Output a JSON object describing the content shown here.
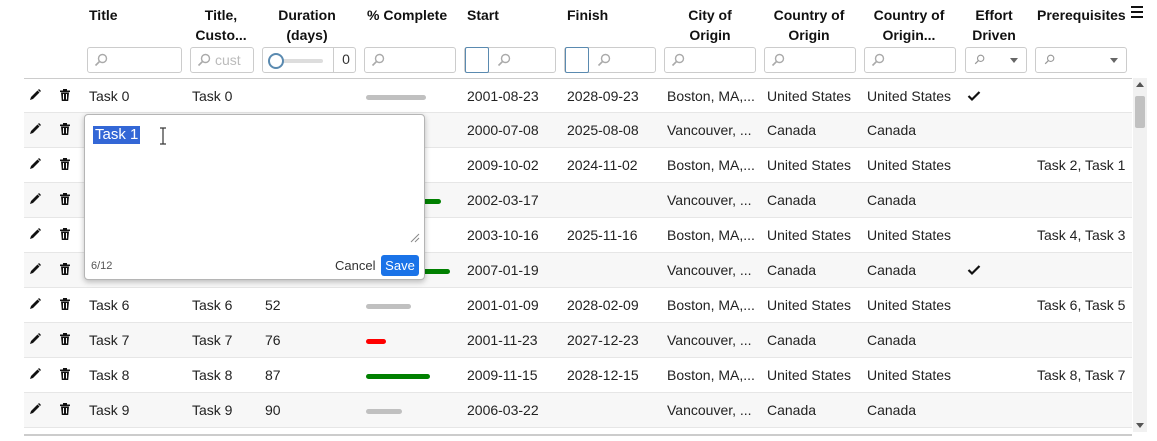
{
  "columns": {
    "title": "Title",
    "title_custom_l1": "Title,",
    "title_custom_l2": "Custo...",
    "duration_l1": "Duration",
    "duration_l2": "(days)",
    "percent": "% Complete",
    "start": "Start",
    "finish": "Finish",
    "city_l1": "City of",
    "city_l2": "Origin",
    "country_l1": "Country of",
    "country_l2": "Origin",
    "country2_l1": "Country of",
    "country2_l2": "Origin...",
    "effort_l1": "Effort",
    "effort_l2": "Driven",
    "prereq": "Prerequisites"
  },
  "filters": {
    "title_custom_placeholder": "cust",
    "duration_value": "0"
  },
  "colors": {
    "green": "#008000",
    "red": "#ff0000",
    "grey": "#c0c0c0",
    "accent": "#1a73e8"
  },
  "rows": [
    {
      "title": "Task 0",
      "title2": "Task 0",
      "duration": "",
      "pct": 0.6,
      "bar": "grey",
      "start": "2001-08-23",
      "finish": "2028-09-23",
      "city": "Boston, MA,...",
      "country": "United States",
      "country2": "United States",
      "effort": true,
      "prereq": ""
    },
    {
      "title": "",
      "title2": "",
      "duration": "",
      "pct": null,
      "bar": "",
      "start": "2000-07-08",
      "finish": "2025-08-08",
      "city": "Vancouver, ...",
      "country": "Canada",
      "country2": "Canada",
      "effort": false,
      "prereq": ""
    },
    {
      "title": "",
      "title2": "",
      "duration": "",
      "pct": null,
      "bar": "",
      "start": "2009-10-02",
      "finish": "2024-11-02",
      "city": "Boston, MA,...",
      "country": "United States",
      "country2": "United States",
      "effort": false,
      "prereq": "Task 2, Task 1"
    },
    {
      "title": "",
      "title2": "",
      "duration": "",
      "pct": 0.75,
      "bar": "green",
      "start": "2002-03-17",
      "finish": "",
      "city": "Vancouver, ...",
      "country": "Canada",
      "country2": "Canada",
      "effort": false,
      "prereq": ""
    },
    {
      "title": "",
      "title2": "",
      "duration": "",
      "pct": null,
      "bar": "",
      "start": "2003-10-16",
      "finish": "2025-11-16",
      "city": "Boston, MA,...",
      "country": "United States",
      "country2": "United States",
      "effort": false,
      "prereq": "Task 4, Task 3"
    },
    {
      "title": "",
      "title2": "",
      "duration": "",
      "pct": 0.84,
      "bar": "green",
      "start": "2007-01-19",
      "finish": "",
      "city": "Vancouver, ...",
      "country": "Canada",
      "country2": "Canada",
      "effort": true,
      "prereq": ""
    },
    {
      "title": "Task 6",
      "title2": "Task 6",
      "duration": "52",
      "pct": 0.45,
      "bar": "grey",
      "start": "2001-01-09",
      "finish": "2028-02-09",
      "city": "Boston, MA,...",
      "country": "United States",
      "country2": "United States",
      "effort": false,
      "prereq": "Task 6, Task 5"
    },
    {
      "title": "Task 7",
      "title2": "Task 7",
      "duration": "76",
      "pct": 0.2,
      "bar": "red",
      "start": "2001-11-23",
      "finish": "2027-12-23",
      "city": "Vancouver, ...",
      "country": "Canada",
      "country2": "Canada",
      "effort": false,
      "prereq": ""
    },
    {
      "title": "Task 8",
      "title2": "Task 8",
      "duration": "87",
      "pct": 0.64,
      "bar": "green",
      "start": "2009-11-15",
      "finish": "2028-12-15",
      "city": "Boston, MA,...",
      "country": "United States",
      "country2": "United States",
      "effort": false,
      "prereq": "Task 8, Task 7"
    },
    {
      "title": "Task 9",
      "title2": "Task 9",
      "duration": "90",
      "pct": 0.36,
      "bar": "grey",
      "start": "2006-03-22",
      "finish": "",
      "city": "Vancouver, ...",
      "country": "Canada",
      "country2": "Canada",
      "effort": false,
      "prereq": ""
    }
  ],
  "editor": {
    "text": "Task 1",
    "counter": "6/12",
    "cancel": "Cancel",
    "save": "Save"
  }
}
